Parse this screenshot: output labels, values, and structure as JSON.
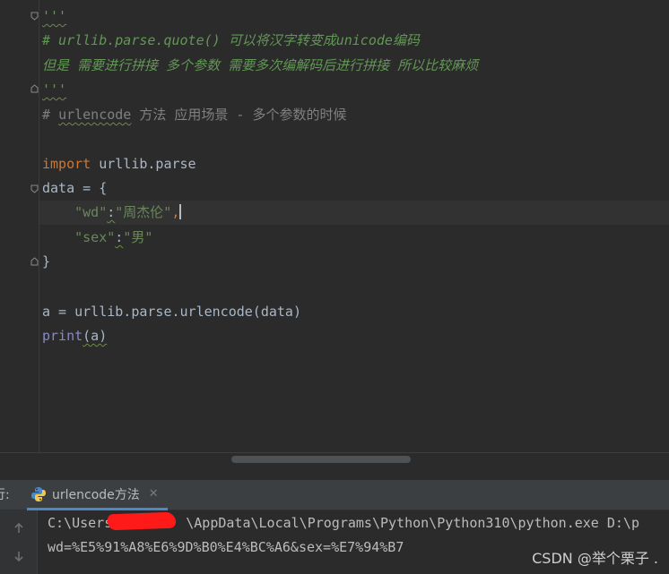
{
  "editor": {
    "lines": [
      {
        "text": "'''",
        "kind": "doc"
      },
      {
        "text": "# urllib.parse.quote() 可以将汉字转变成unicode编码",
        "kind": "doc"
      },
      {
        "text": "但是 需要进行拼接 多个参数 需要多次编解码后进行拼接 所以比较麻烦",
        "kind": "doc"
      },
      {
        "text": "'''",
        "kind": "doc"
      },
      {
        "comment_prefix": "# ",
        "comment_word": "urlencode",
        "comment_rest": " 方法 应用场景 - 多个参数的时候"
      },
      {
        "text": ""
      },
      {
        "kw": "import",
        "rest": " urllib.parse"
      },
      {
        "text": "data = {"
      },
      {
        "indent": "    ",
        "key": "\"wd\"",
        "colon": ":",
        "value": "\"周杰伦\"",
        "comma": ","
      },
      {
        "indent": "    ",
        "key": "\"sex\"",
        "colon": ":",
        "value": "\"男\""
      },
      {
        "text": "}"
      },
      {
        "text": ""
      },
      {
        "text": "a = urllib.parse.urlencode(data)"
      },
      {
        "fn": "print",
        "args": "(a)"
      }
    ]
  },
  "run_panel": {
    "label": "行:",
    "tab_label": "urlencode方法",
    "close_glyph": "✕",
    "icons": [
      "python-icon",
      "close-icon",
      "up-arrow-icon",
      "down-arrow-icon"
    ]
  },
  "console": {
    "command_prefix": "C:\\Users",
    "command_rest": "\\AppData\\Local\\Programs\\Python\\Python310\\python.exe D:\\p",
    "output": "wd=%E5%91%A8%E6%9D%B0%E4%BC%A6&sex=%E7%94%B7"
  },
  "watermark": "CSDN @举个栗子 ."
}
